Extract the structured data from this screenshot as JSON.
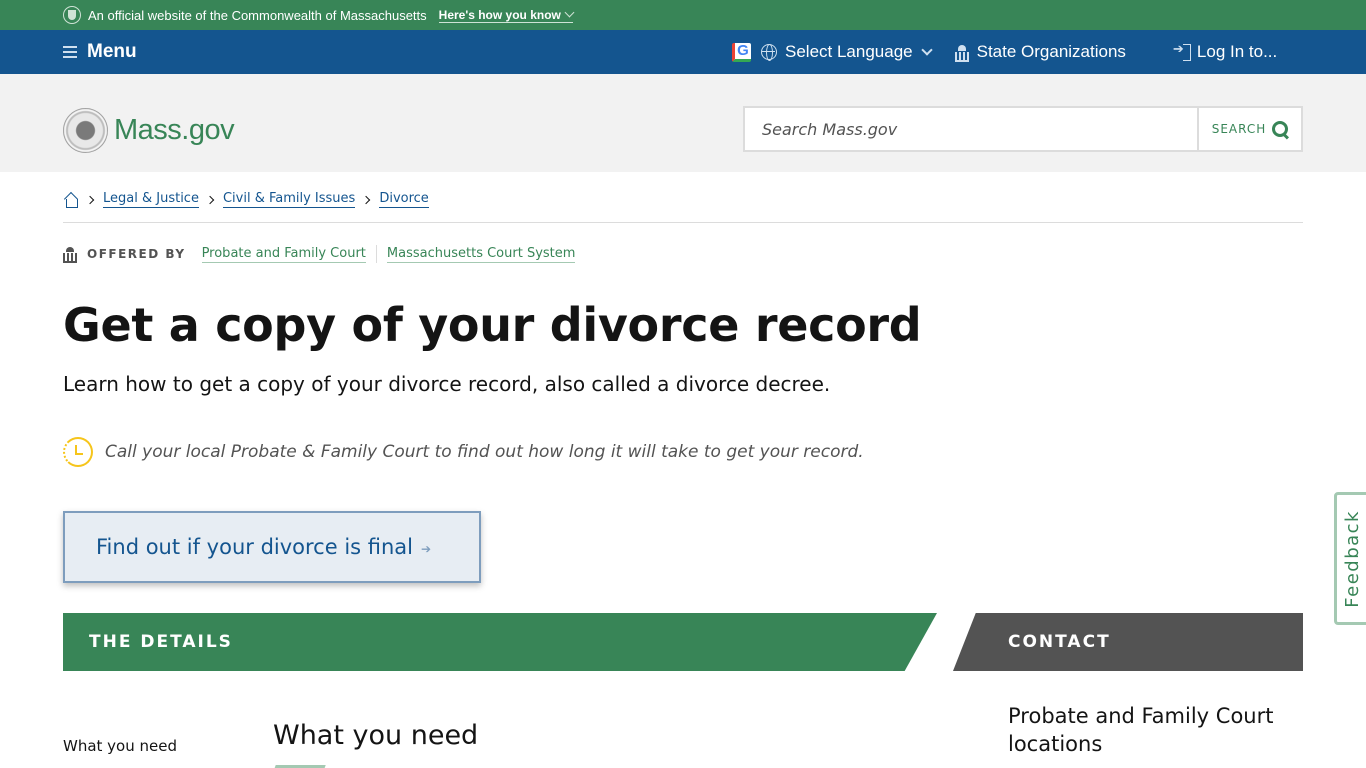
{
  "official_banner": {
    "text": "An official website of the Commonwealth of Massachusetts",
    "how_you_know": "Here's how you know"
  },
  "utility_nav": {
    "menu_label": "Menu",
    "google_letter": "G",
    "language_label": "Select Language",
    "state_orgs_label": "State Organizations",
    "login_label": "Log In to..."
  },
  "header": {
    "logo_text": "Mass.gov",
    "search_placeholder": "Search Mass.gov",
    "search_button": "SEARCH"
  },
  "breadcrumb": {
    "items": [
      "Legal & Justice",
      "Civil & Family Issues",
      "Divorce"
    ]
  },
  "offered_by": {
    "label": "OFFERED BY",
    "orgs": [
      "Probate and Family Court",
      "Massachusetts Court System"
    ]
  },
  "page": {
    "title": "Get a copy of your divorce record",
    "subtitle": "Learn how to get a copy of your divorce record, also called a divorce decree.",
    "timing_note": "Call your local Probate & Family Court to find out how long it will take to get your record.",
    "cta_label": "Find out if your divorce is final",
    "cta_arrow": "➔"
  },
  "details": {
    "band_label": "THE DETAILS",
    "toc": [
      "What you need"
    ],
    "section_heading": "What you need"
  },
  "contact": {
    "band_label": "CONTACT",
    "heading": "Probate and Family Court locations"
  },
  "feedback": {
    "label": "Feedback"
  },
  "colors": {
    "brand_green": "#388557",
    "nav_blue": "#14558f",
    "contact_gray": "#535353",
    "clock_yellow": "#f6c51b"
  }
}
